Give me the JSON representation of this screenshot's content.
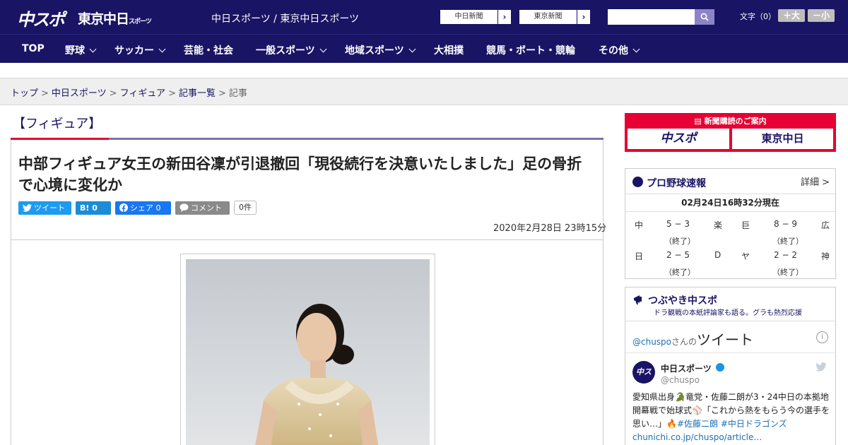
{
  "header": {
    "logo_chuspo": "中スポ",
    "logo_tokyo": "東京中日",
    "logo_tokyo_small": "スポーツ",
    "site_name": "中日スポーツ / 東京中日スポーツ",
    "paper_buttons": [
      {
        "label": "中日新聞"
      },
      {
        "label": "東京新聞"
      }
    ],
    "search": {
      "placeholder": ""
    },
    "font_size": {
      "label": "文字（0）",
      "plus": "＋大",
      "minus": "－小"
    }
  },
  "nav": [
    {
      "label": "TOP",
      "dropdown": false
    },
    {
      "label": "野球",
      "dropdown": true
    },
    {
      "label": "サッカー",
      "dropdown": true
    },
    {
      "label": "芸能・社会",
      "dropdown": false
    },
    {
      "label": "一般スポーツ",
      "dropdown": true
    },
    {
      "label": "地域スポーツ",
      "dropdown": true
    },
    {
      "label": "大相撲",
      "dropdown": false
    },
    {
      "label": "競馬・ボート・競輪",
      "dropdown": false
    },
    {
      "label": "その他",
      "dropdown": true
    }
  ],
  "breadcrumb": [
    "トップ",
    "中日スポーツ",
    "フィギュア",
    "記事一覧",
    "記事"
  ],
  "article": {
    "category": "【フィギュア】",
    "headline": "中部フィギュア女王の新田谷凜が引退撤回「現役続行を決意いたしました」足の骨折で心境に変化か",
    "share": {
      "tweet": "ツイート",
      "hatena_count": "0",
      "facebook": "シェア 0",
      "comment": "コメント",
      "comment_count": "0件"
    },
    "date": "2020年2月28日 23時15分"
  },
  "sidebar": {
    "subscribe": {
      "title": "新聞購読のご案内",
      "logo1": "中スポ",
      "logo2": "東京中日"
    },
    "baseball": {
      "title": "プロ野球速報",
      "detail": "詳細 >",
      "updated": "02月24日16時32分現在",
      "games": [
        {
          "home": "中",
          "score": "5 − 3",
          "away": "楽",
          "status": "（終了）"
        },
        {
          "home": "巨",
          "score": "8 − 9",
          "away": "広",
          "status": "（終了）"
        },
        {
          "home": "日",
          "score": "2 − 5",
          "away": "D",
          "status": "（終了）"
        },
        {
          "home": "ヤ",
          "score": "2 − 2",
          "away": "神",
          "status": "（終了）"
        }
      ]
    },
    "tsubuyaki": {
      "title": "つぶやき中スポ",
      "subtitle": "ドラ観戦の本紙評論家も語る。グラも熱烈応援"
    },
    "tweets": {
      "handle_link": "@chuspo",
      "san": "さんの",
      "label": "ツイート",
      "info": "i",
      "avatar": "中スポ",
      "name": "中日スポーツ",
      "handle": "@chuspo",
      "text_pre": "愛知県出身🐊竜党・佐藤二朗が3・24中日の本拠地開幕戦で始球式⚾「これから熱をもらう今の選手を思い…」🔥",
      "tag1": "#佐藤二朗",
      "tag2": "#中日ドラゴンズ",
      "link": "chunichi.co.jp/chuspo/article…"
    }
  }
}
